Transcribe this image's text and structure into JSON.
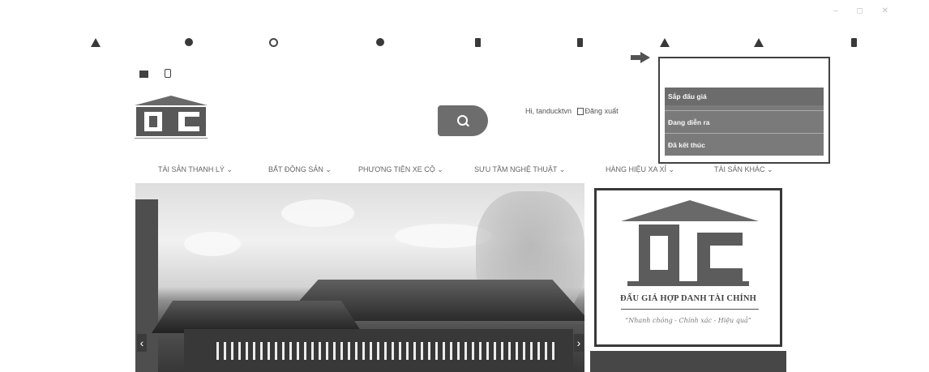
{
  "browser": {
    "address": "",
    "window_controls": "– ◻ ✕"
  },
  "bookmarks": [
    {
      "label": "",
      "icon": "bookmark-icon"
    },
    {
      "label": "",
      "icon": "location-icon"
    },
    {
      "label": "",
      "icon": "location-icon"
    },
    {
      "label": "",
      "icon": "google-icon"
    },
    {
      "label": "",
      "icon": "globe-icon"
    },
    {
      "label": "",
      "icon": "bookmark-icon"
    },
    {
      "label": "",
      "icon": "document-icon"
    },
    {
      "label": "",
      "icon": "drive-icon"
    },
    {
      "label": "",
      "icon": "drive-icon"
    },
    {
      "label": "",
      "icon": "bookmark-icon"
    }
  ],
  "contact": {
    "email": "",
    "hotline": ""
  },
  "header_links": "",
  "logo": {
    "sub_text": ""
  },
  "account": {
    "greeting": "Hi, tanducktvn",
    "logout": "Đăng xuất",
    "account_link": ""
  },
  "nav": [
    "TÀI SẢN THANH LÝ ⌄",
    "BẤT ĐỘNG SẢN ⌄",
    "PHƯƠNG TIỆN XE CỘ ⌄",
    "SƯU TẦM NGHỆ THUẬT ⌄",
    "HÀNG HIỆU XA XỈ ⌄",
    "TÀI SẢN KHÁC ⌄"
  ],
  "dropdown": {
    "tabs": [],
    "items": [
      "Sắp đấu giá",
      "Đang diễn ra",
      "Đã kết thúc"
    ],
    "background_text": ""
  },
  "ad": {
    "title": "ĐẤU GIÁ HỢP DANH TÀI CHÍNH",
    "slogan": "“Nhanh chóng - Chính xác - Hiệu quả”"
  },
  "hero": {
    "prev": "‹",
    "next": "›"
  }
}
